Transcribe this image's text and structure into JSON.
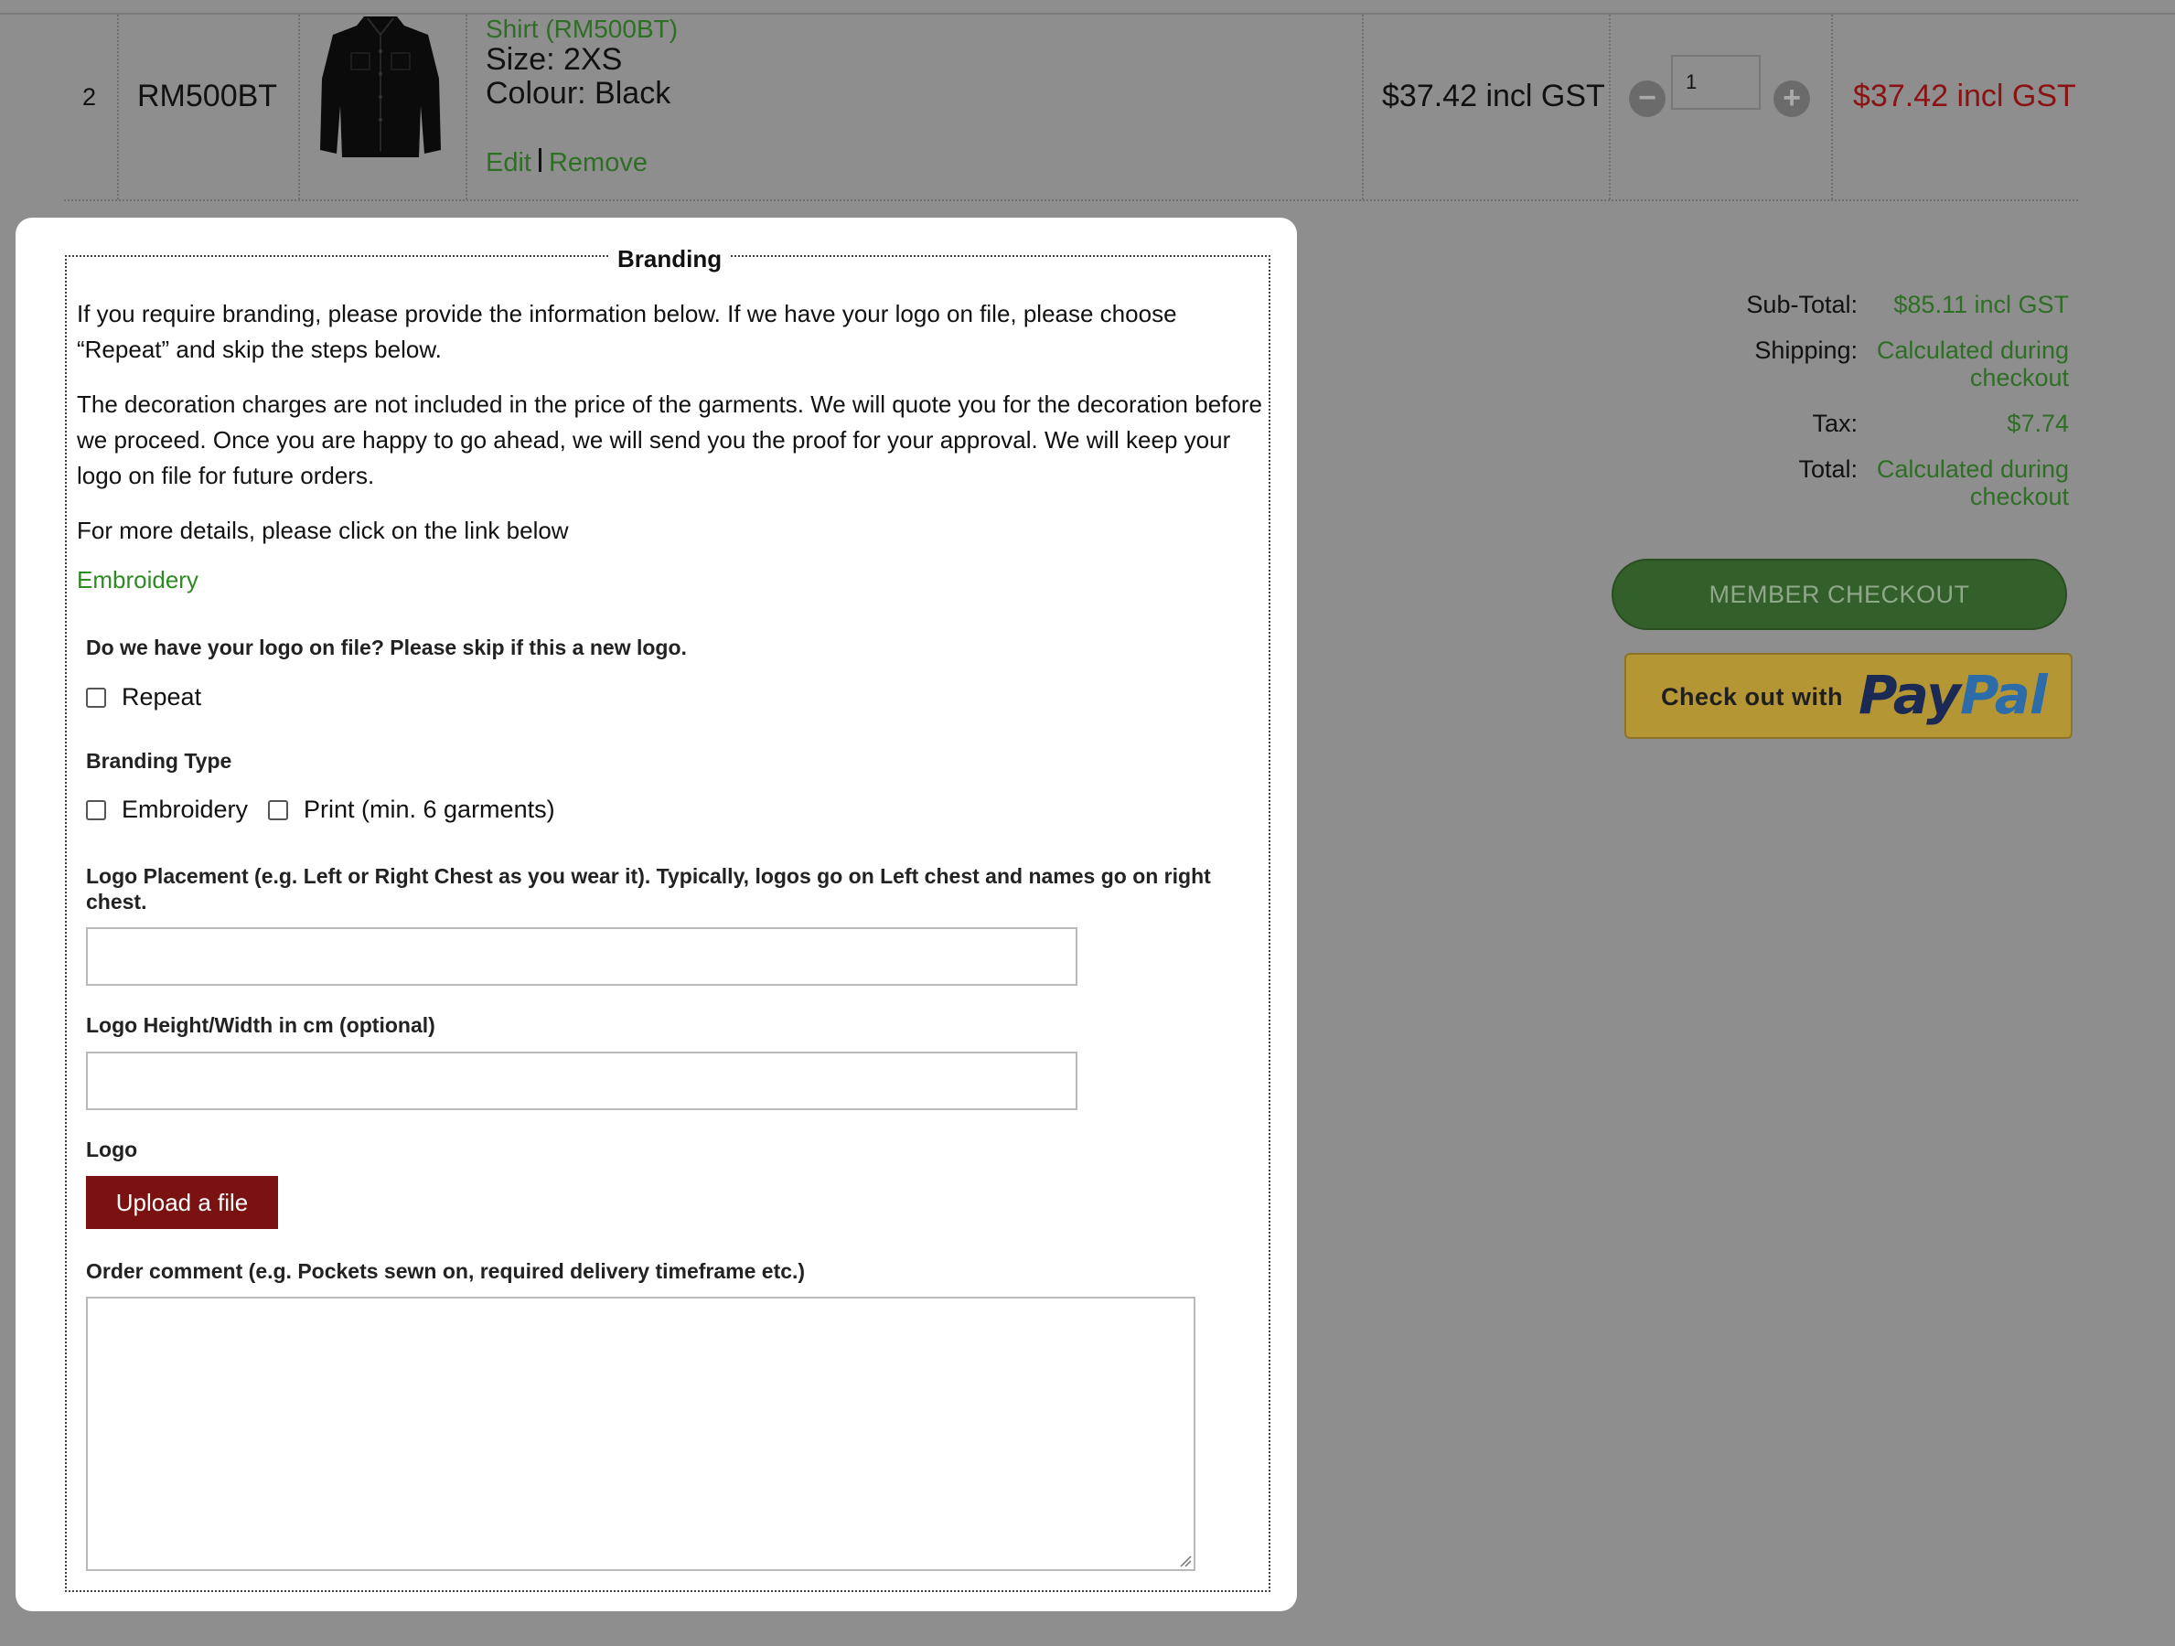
{
  "cart": {
    "row": {
      "number": "2",
      "sku": "RM500BT",
      "product_name": "Shirt (RM500BT)",
      "size": "Size: 2XS",
      "colour": "Colour: Black",
      "edit_label": "Edit",
      "remove_label": "Remove",
      "unit_price": "$37.42 incl GST",
      "quantity": "1",
      "line_total": "$37.42 incl GST"
    }
  },
  "totals": {
    "subtotal_label": "Sub-Total:",
    "subtotal_value": "$85.11 incl GST",
    "shipping_label": "Shipping:",
    "shipping_value": "Calculated during checkout",
    "tax_label": "Tax:",
    "tax_value": "$7.74",
    "total_label": "Total:",
    "total_value": "Calculated during checkout"
  },
  "checkout": {
    "member_label": "MEMBER CHECKOUT",
    "paypal_prefix": "Check out with",
    "paypal_logo_1": "Pay",
    "paypal_logo_2": "Pal"
  },
  "branding": {
    "legend": "Branding",
    "intro": "If you require branding, please provide the information below. If we have your logo on file, please choose “Repeat” and skip the steps below.",
    "charges": "The decoration charges are not included in the price of the garments. We will quote you for the decoration before we proceed. Once you are happy to go ahead, we will send you the proof for your approval. We will keep your logo on file for future orders.",
    "more_details": "For more details, please click on the link below",
    "link_label": "Embroidery",
    "logo_on_file_label": "Do we have your logo on file? Please skip if this a new logo.",
    "repeat_label": "Repeat",
    "branding_type_label": "Branding Type",
    "embroidery_option": "Embroidery",
    "print_option": "Print (min. 6 garments)",
    "placement_label": "Logo Placement (e.g. Left or Right Chest as you wear it). Typically, logos go on Left chest and names go on right chest.",
    "placement_value": "",
    "size_label": "Logo Height/Width in cm (optional)",
    "size_value": "",
    "logo_label": "Logo",
    "upload_label": "Upload a file",
    "comment_label": "Order comment (e.g. Pockets sewn on, required delivery timeframe etc.)",
    "comment_value": ""
  },
  "colors": {
    "overlay": "#8e8e8e",
    "link_green": "#2e6e25",
    "price_red": "#8a1212",
    "upload_red": "#7a1212",
    "member_green": "#335f2a",
    "paypal_gold": "#b59635"
  }
}
